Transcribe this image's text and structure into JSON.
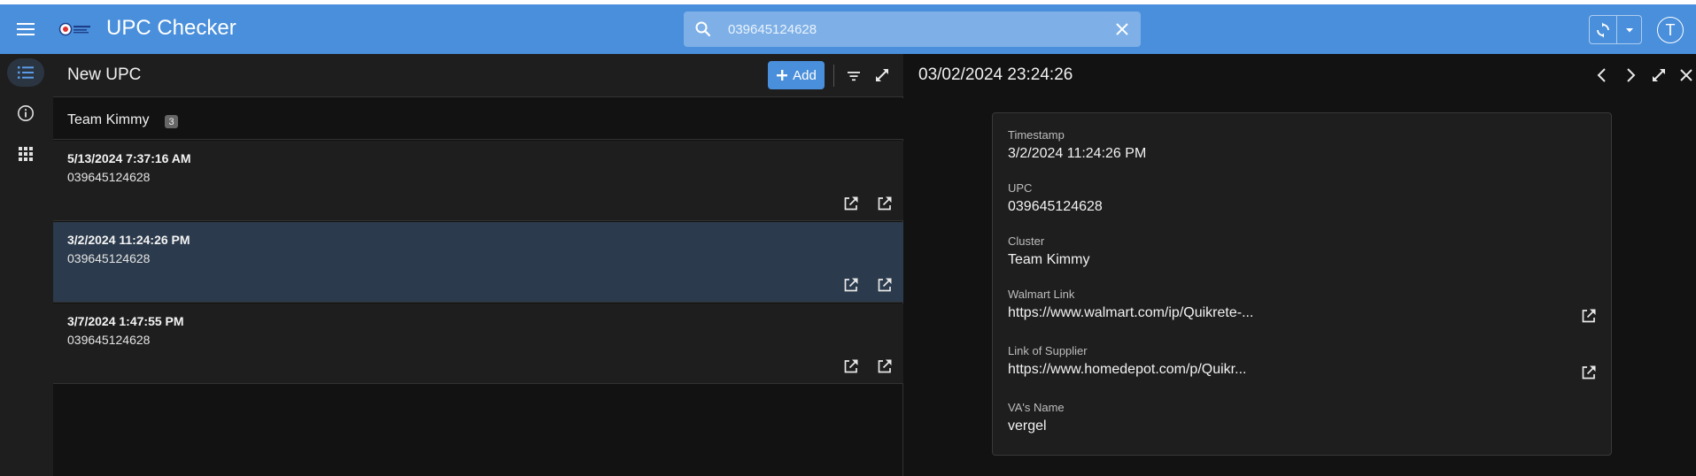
{
  "app": {
    "title": "UPC Checker",
    "logo_text": "",
    "user_initial": "T"
  },
  "search": {
    "value": "039645124628",
    "placeholder": "039645124628"
  },
  "list": {
    "title": "New UPC",
    "add_label": "Add",
    "group": {
      "name": "Team Kimmy",
      "count": "3"
    },
    "items": [
      {
        "timestamp": "5/13/2024 7:37:16 AM",
        "upc": "039645124628"
      },
      {
        "timestamp": "3/2/2024 11:24:26 PM",
        "upc": "039645124628"
      },
      {
        "timestamp": "3/7/2024 1:47:55 PM",
        "upc": "039645124628"
      }
    ]
  },
  "detail": {
    "title": "03/02/2024 23:24:26",
    "fields": [
      {
        "label": "Timestamp",
        "value": "3/2/2024 11:24:26 PM"
      },
      {
        "label": "UPC",
        "value": "039645124628"
      },
      {
        "label": "Cluster",
        "value": "Team Kimmy"
      },
      {
        "label": "Walmart Link",
        "value": "https://www.walmart.com/ip/Quikrete-..."
      },
      {
        "label": "Link of Supplier",
        "value": "https://www.homedepot.com/p/Quikr..."
      },
      {
        "label": "VA's Name",
        "value": "vergel"
      }
    ]
  },
  "colors": {
    "appbar": "#4a8fdb",
    "selected_row": "#2b3a4c",
    "accent": "#4a8fdb"
  }
}
